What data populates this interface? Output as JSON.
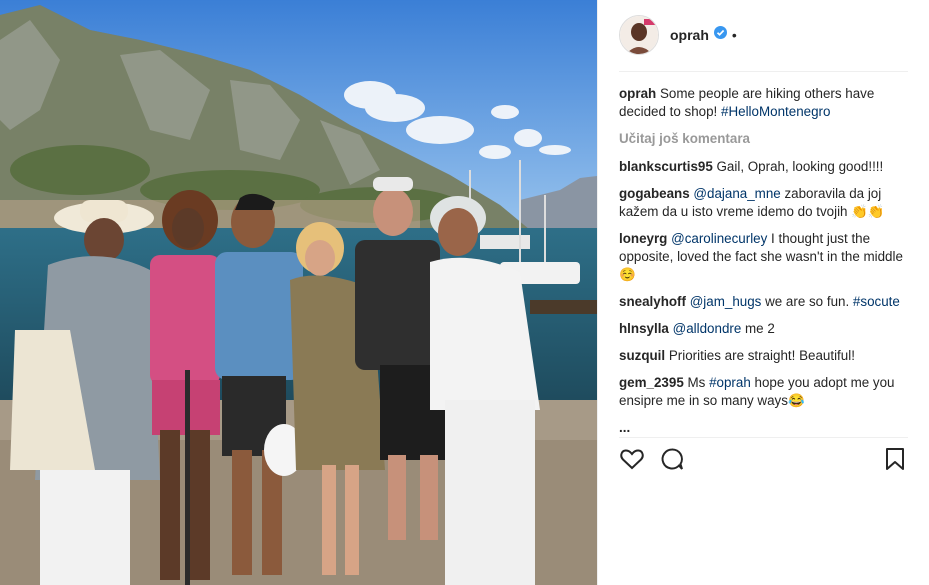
{
  "post": {
    "username": "oprah",
    "more_comments_label": "Učitaj još komentara"
  },
  "caption": {
    "user": "oprah",
    "text": "Some people are hiking others have decided to shop!",
    "hashtag": "#HelloMontenegro"
  },
  "comments": [
    {
      "user": "blankscurtis95",
      "parts": [
        {
          "t": "Gail, Oprah, looking good!!!!"
        }
      ]
    },
    {
      "user": "gogabeans",
      "parts": [
        {
          "t": "@dajana_mne",
          "link": true
        },
        {
          "t": " zaboravila da joj kažem da u isto vreme idemo do tvojih 👏👏"
        }
      ]
    },
    {
      "user": "loneyrg",
      "parts": [
        {
          "t": "@carolinecurley",
          "link": true
        },
        {
          "t": " I thought just the opposite, loved the fact she wasn't in the middle☺️"
        }
      ]
    },
    {
      "user": "snealyhoff",
      "parts": [
        {
          "t": "@jam_hugs",
          "link": true
        },
        {
          "t": " we are so fun. "
        },
        {
          "t": "#socute",
          "link": true
        }
      ]
    },
    {
      "user": "hlnsylla",
      "parts": [
        {
          "t": "@alldondre",
          "link": true
        },
        {
          "t": " me 2"
        }
      ]
    },
    {
      "user": "suzquil",
      "parts": [
        {
          "t": "Priorities are straight! Beautiful!"
        }
      ]
    },
    {
      "user": "gem_2395",
      "parts": [
        {
          "t": "Ms "
        },
        {
          "t": "#oprah",
          "link": true
        },
        {
          "t": " hope you adopt me you ensipre me in so many ways😂"
        }
      ]
    },
    {
      "user": "...",
      "parts": [
        {
          "t": ""
        }
      ]
    }
  ],
  "icons": {
    "verified": "verified-badge-icon",
    "like": "heart-icon",
    "comment": "comment-bubble-icon",
    "save": "bookmark-icon"
  },
  "colors": {
    "link": "#003569",
    "verified": "#3897f0",
    "muted": "#999999"
  }
}
